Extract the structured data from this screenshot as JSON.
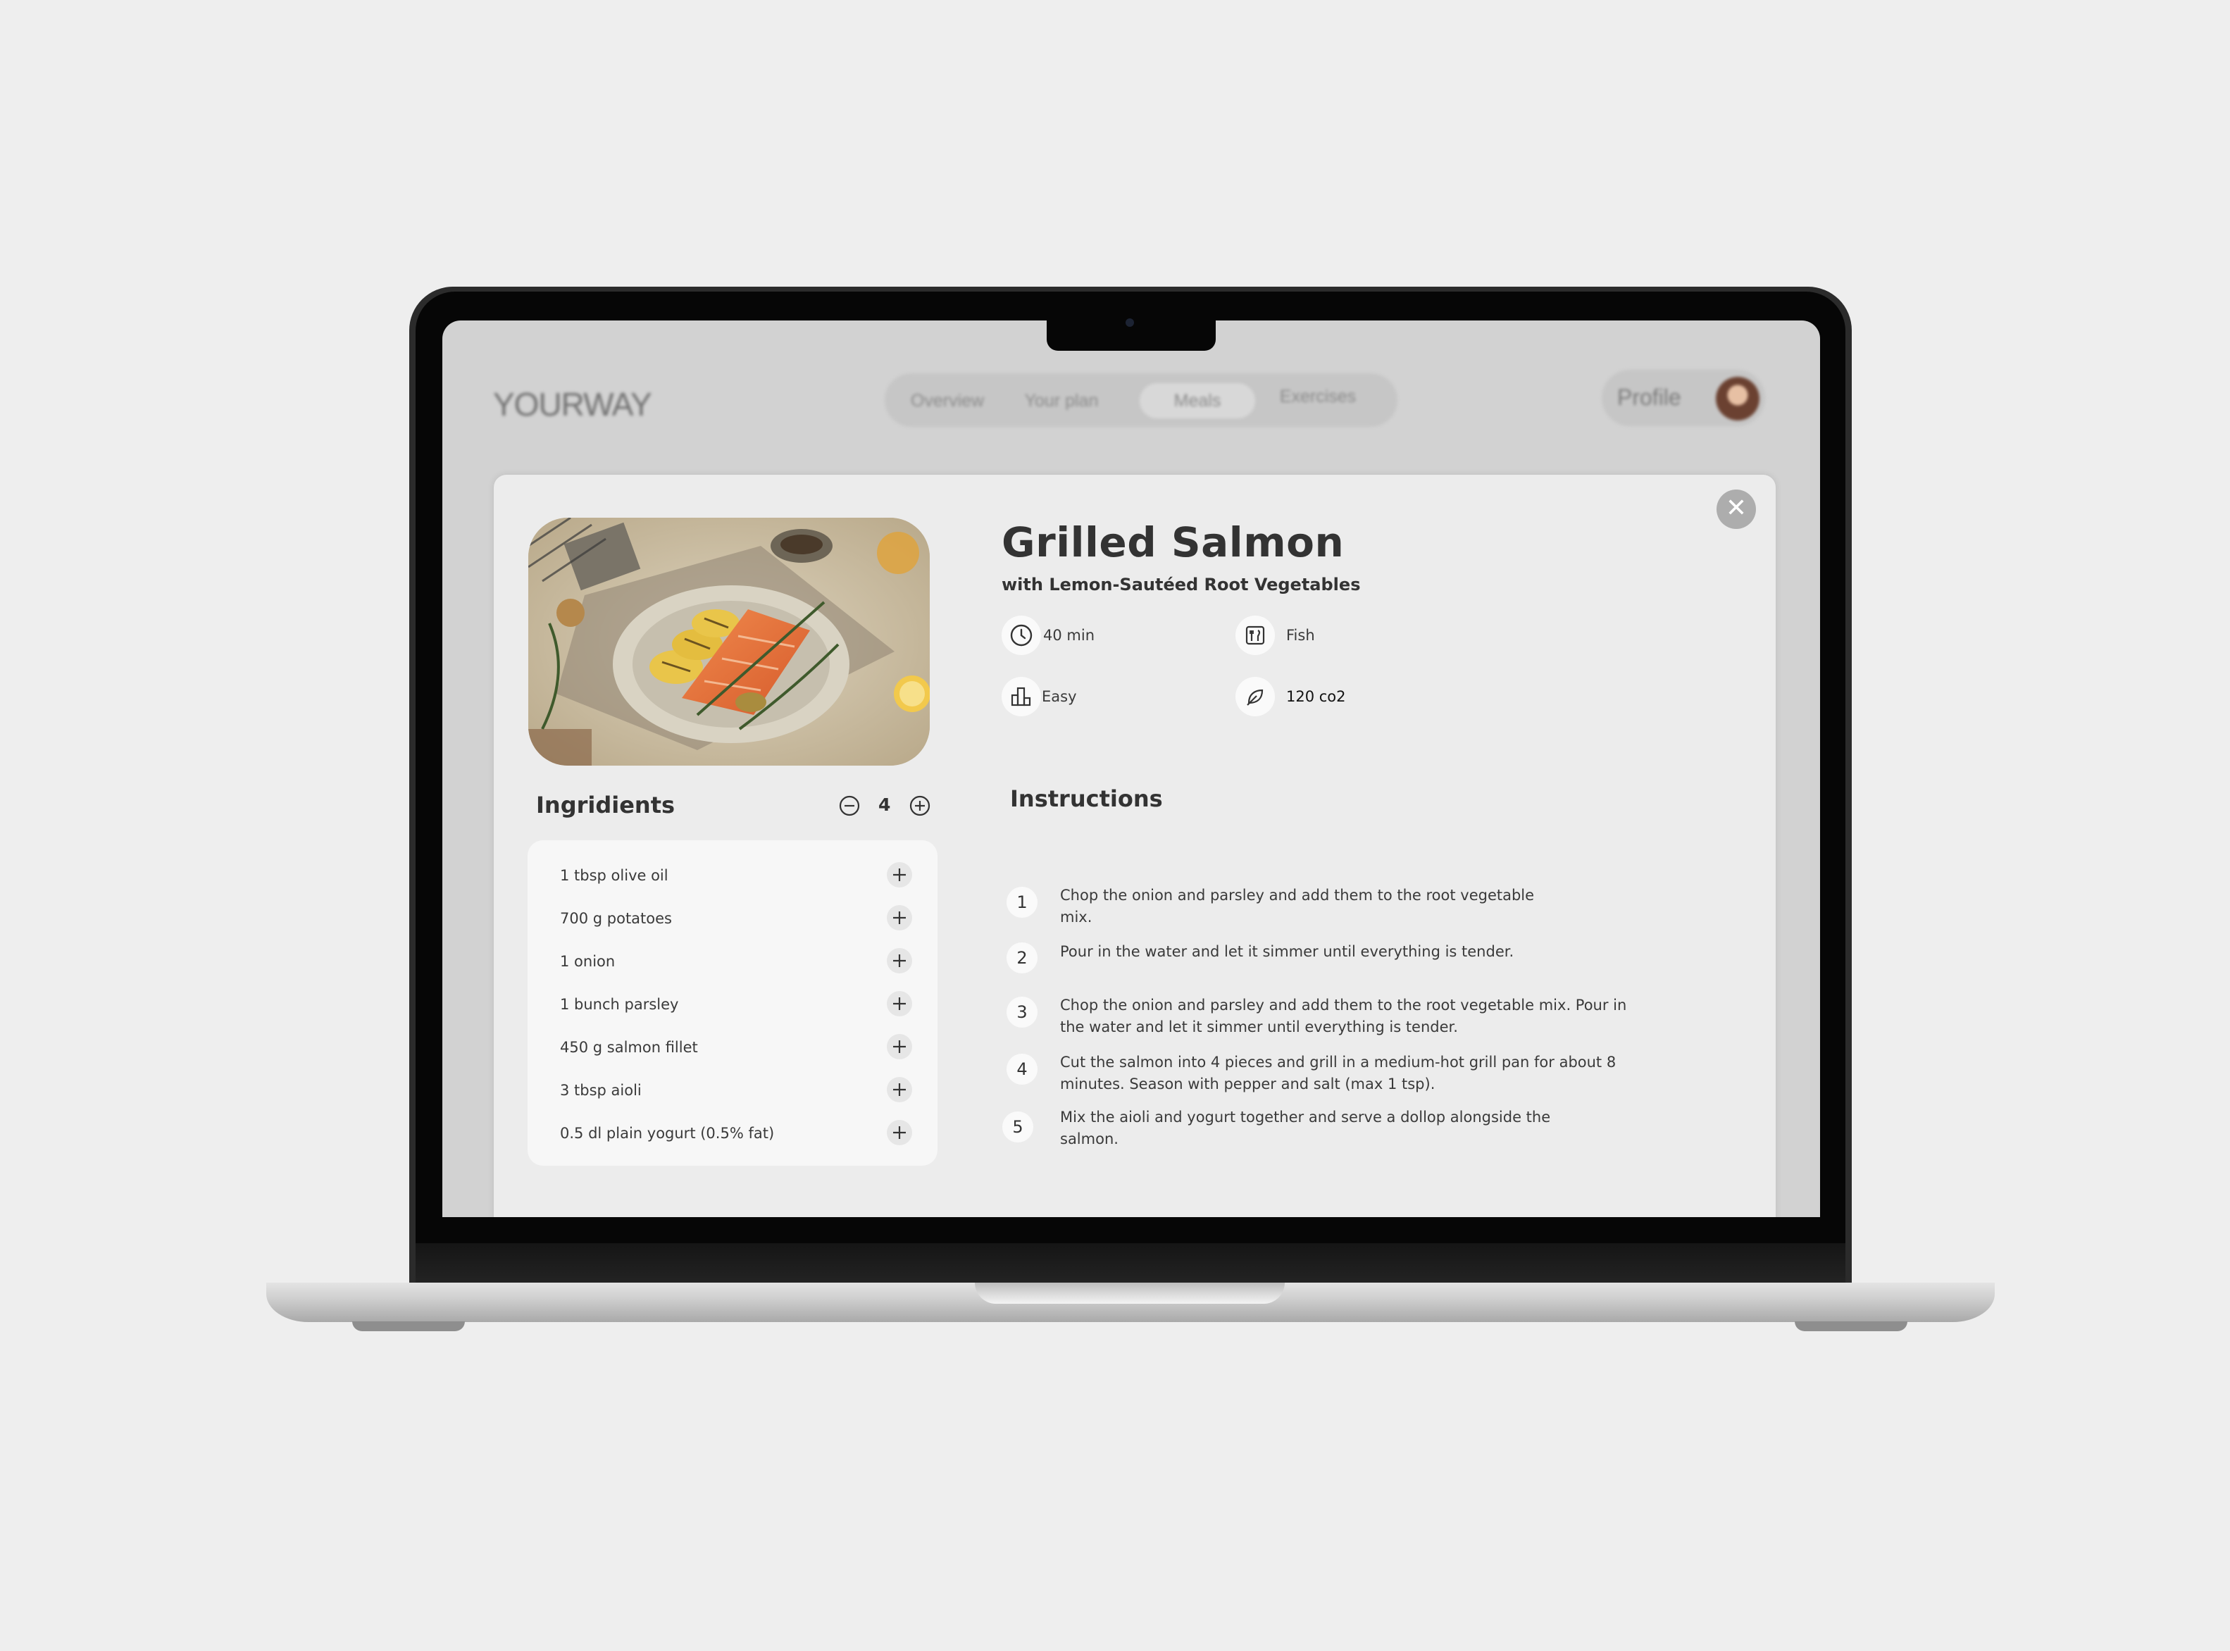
{
  "app": {
    "logo": "YOURWAY",
    "nav": [
      {
        "label": "Overview"
      },
      {
        "label": "Your plan"
      },
      {
        "label": "Meals"
      },
      {
        "label": "Exercises"
      }
    ],
    "active_nav": "Meals",
    "profile_label": "Profile"
  },
  "recipe": {
    "title": "Grilled Salmon",
    "subtitle": "with Lemon-Sautéed Root Vegetables",
    "meta": {
      "time": "40 min",
      "category": "Fish",
      "difficulty": "Easy",
      "co2": "120 co2"
    },
    "ingredients_title": "Ingridients",
    "servings": "4",
    "ingredients": [
      {
        "name": "1 tbsp olive oil"
      },
      {
        "name": "700 g potatoes"
      },
      {
        "name": "1 onion"
      },
      {
        "name": "1 bunch parsley"
      },
      {
        "name": "450 g salmon fillet"
      },
      {
        "name": "3 tbsp aioli"
      },
      {
        "name": "0.5 dl plain yogurt (0.5% fat)"
      }
    ],
    "instructions_title": "Instructions",
    "steps": [
      {
        "num": "1",
        "line1": "Chop the onion and parsley and add them to the root vegetable",
        "line2": "mix."
      },
      {
        "num": "2",
        "line1": "Pour in the water and let it simmer until everything is tender.",
        "line2": ""
      },
      {
        "num": "3",
        "line1": "Chop the onion and parsley and add them to the root vegetable mix. Pour in",
        "line2": "the water and let it simmer until everything is tender."
      },
      {
        "num": "4",
        "line1": "Cut the salmon into 4 pieces and grill in a medium-hot grill pan for about 8",
        "line2": "minutes. Season with pepper and salt (max 1 tsp)."
      },
      {
        "num": "5",
        "line1": "Mix the aioli and yogurt together and serve a dollop alongside the",
        "line2": "salmon."
      }
    ]
  },
  "icons": {
    "close": "close-icon",
    "time": "clock-icon",
    "category": "cutlery-icon",
    "difficulty": "bar-chart-icon",
    "co2": "leaf-icon",
    "minus": "minus-circle-icon",
    "plus": "plus-circle-icon",
    "add": "plus-icon"
  },
  "colors": {
    "background": "#eeeeee",
    "modal": "#ececec",
    "card": "#f7f7f7",
    "text": "#333333"
  }
}
